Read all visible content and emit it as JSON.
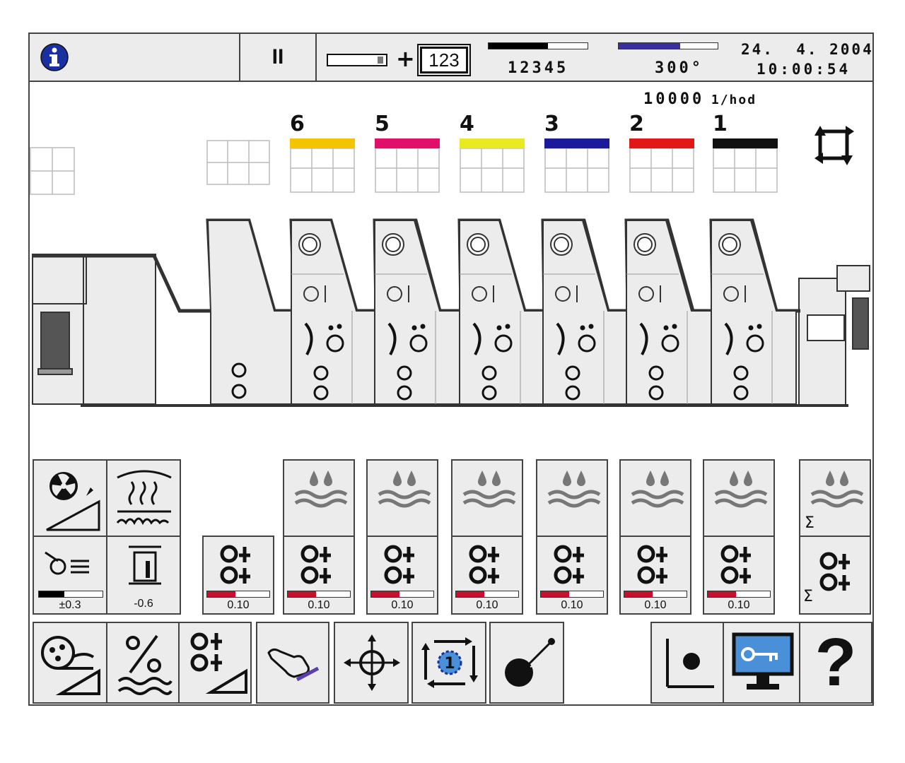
{
  "topbar": {
    "info_icon": "info-icon",
    "pause_label": "II",
    "counter_box": "123",
    "plus": "+",
    "sheet_counter": "12345",
    "sheet_counter_progress": 0.6,
    "angle": "300°",
    "angle_progress": 0.62,
    "date": "24.  4. 2004",
    "time": "10:00:54"
  },
  "speed": {
    "value": "10000",
    "unit": "1/hod"
  },
  "units": [
    {
      "number": "6",
      "color": "#f5c400"
    },
    {
      "number": "5",
      "color": "#e0106a"
    },
    {
      "number": "4",
      "color": "#eaea20"
    },
    {
      "number": "3",
      "color": "#1a1a9a"
    },
    {
      "number": "2",
      "color": "#e01818"
    },
    {
      "number": "1",
      "color": "#111111"
    }
  ],
  "left_panel": {
    "dampening_offset": "±0.3",
    "dampening_progress": 0.4,
    "register_value": "-0.6"
  },
  "ink_values": [
    "0.10",
    "0.10",
    "0.10",
    "0.10",
    "0.10",
    "0.10",
    "0.10"
  ],
  "ink_progress": 0.45,
  "colors": {
    "accent_red": "#c8102e",
    "panel": "#ececec",
    "border": "#444444",
    "blue_info": "#1a2fa0",
    "monitor_blue": "#4a90d9"
  }
}
